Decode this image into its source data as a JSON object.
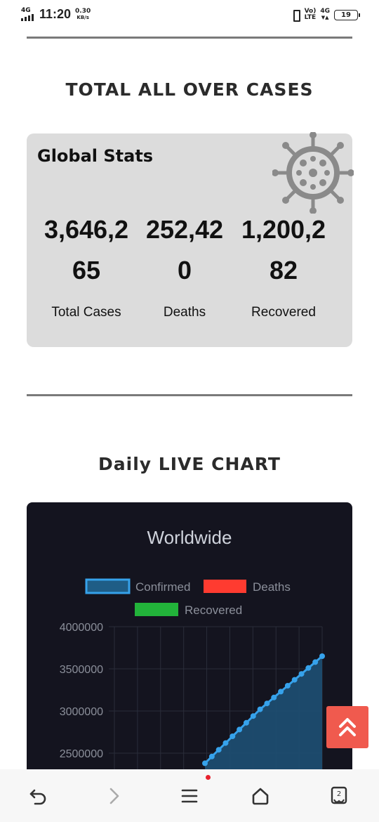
{
  "status_bar": {
    "network_left": "4G",
    "time": "11:20",
    "speed_value": "0.30",
    "speed_unit": "KB/s",
    "volte": "Vo)",
    "volte_sub": "LTE",
    "network_right": "4G",
    "battery": "19"
  },
  "section1": {
    "title": "TOTAL ALL OVER CASES"
  },
  "global_stats": {
    "title": "Global Stats",
    "icon": "virus-icon",
    "stats": [
      {
        "value": "3,646,265",
        "label": "Total Cases"
      },
      {
        "value": "252,420",
        "label": "Deaths"
      },
      {
        "value": "1,200,282",
        "label": "Recovered"
      }
    ]
  },
  "section2": {
    "title": "Daily LIVE CHART"
  },
  "chart_data": {
    "type": "line",
    "title": "Worldwide",
    "legend": [
      {
        "name": "Confirmed",
        "color": "#36a2eb"
      },
      {
        "name": "Deaths",
        "color": "#ff3b30"
      },
      {
        "name": "Recovered",
        "color": "#22b33a"
      }
    ],
    "y_ticks": [
      "4000000",
      "3500000",
      "3000000",
      "2500000"
    ],
    "ylim": [
      2350000,
      4000000
    ],
    "grid": true,
    "series": [
      {
        "name": "Confirmed",
        "values": [
          2380000,
          2460000,
          2540000,
          2620000,
          2700000,
          2780000,
          2860000,
          2940000,
          3020000,
          3090000,
          3160000,
          3230000,
          3300000,
          3370000,
          3440000,
          3510000,
          3580000,
          3650000
        ]
      }
    ]
  },
  "scroll_top_button": {
    "icon": "double-chevron-up-icon"
  },
  "bottom_nav": {
    "back": "back-icon",
    "forward": "forward-icon",
    "menu": "menu-icon",
    "home": "home-icon",
    "tabs_count": "2"
  },
  "colors": {
    "card_bg": "#dcdcdc",
    "chart_bg": "#14141f",
    "confirmed": "#36a2eb",
    "deaths": "#ff3b30",
    "recovered": "#22b33a",
    "scroll_button": "#f05a4e"
  }
}
